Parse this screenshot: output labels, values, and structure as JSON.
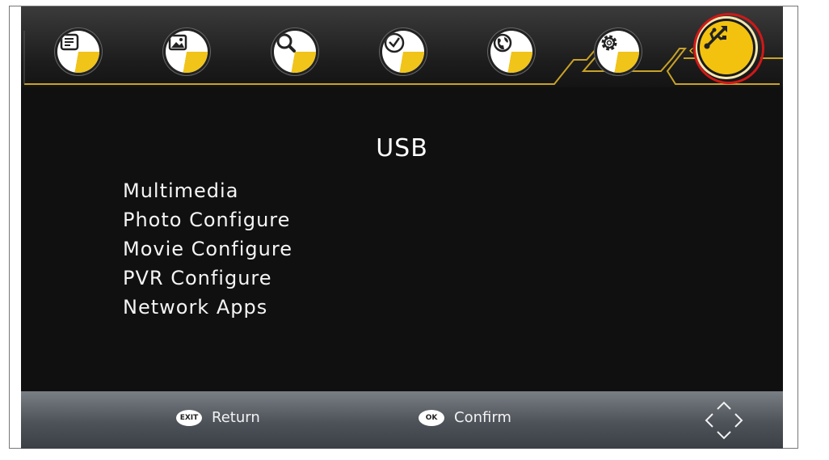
{
  "menu": {
    "title": "USB",
    "items": [
      "Multimedia",
      "Photo Configure",
      "Movie Configure",
      "PVR Configure",
      "Network Apps"
    ]
  },
  "topbar": {
    "icons": [
      "program-icon",
      "picture-icon",
      "search-icon",
      "time-icon",
      "option-icon",
      "system-icon",
      "usb-icon"
    ],
    "selected": "usb-icon",
    "accent": "#f2c20f",
    "highlight_color": "#d01818"
  },
  "footer": {
    "exit_key": "EXIT",
    "exit_label": "Return",
    "ok_key": "OK",
    "ok_label": "Confirm",
    "nav_icon": "dpad-icon"
  }
}
